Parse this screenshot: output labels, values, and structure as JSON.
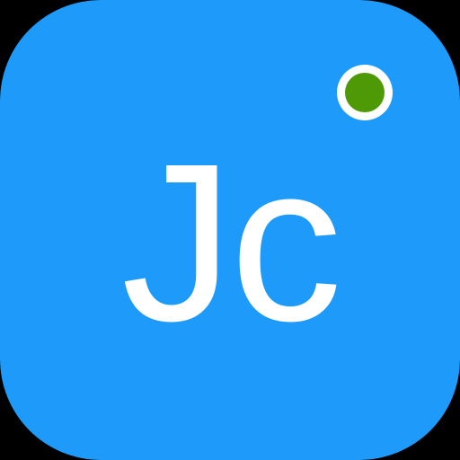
{
  "app_icon": {
    "monogram": "Jc",
    "colors": {
      "background": "#1E9BFA",
      "monogram": "#FFFFFF",
      "status_dot": "#4E9A06",
      "status_ring": "#FFFFFF"
    },
    "status_indicator": {
      "icon": "online-status-dot",
      "state": "online"
    }
  }
}
